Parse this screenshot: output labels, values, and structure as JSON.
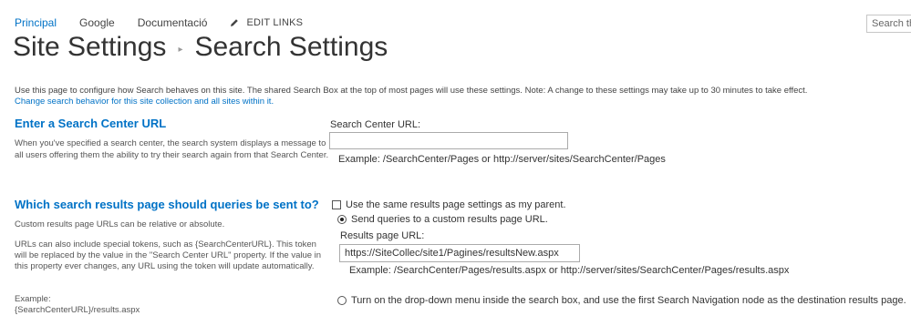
{
  "nav": {
    "items": [
      "Principal",
      "Google",
      "Documentació"
    ],
    "edit_links": "EDIT LINKS"
  },
  "search": {
    "placeholder": "Search this"
  },
  "title": {
    "part1": "Site Settings",
    "part2": "Search Settings"
  },
  "description": "Use this page to configure how Search behaves on this site. The shared Search Box at the top of most pages will use these settings. Note: A change to these settings may take up to 30 minutes to take effect.",
  "change_link": "Change search behavior for this site collection and all sites within it.",
  "section1": {
    "heading": "Enter a Search Center URL",
    "description": "When you've specified a search center, the search system displays a message to all users offering them the ability to try their search again from that Search Center.",
    "field_label": "Search Center URL:",
    "field_value": "",
    "example": "Example: /SearchCenter/Pages or http://server/sites/SearchCenter/Pages"
  },
  "section2": {
    "heading": "Which search results page should queries be sent to?",
    "text1": "Custom results page URLs can be relative or absolute.",
    "text2": "URLs can also include special tokens, such as {SearchCenterURL}. This token will be replaced by the value in the \"Search Center URL\" property. If the value in this property ever changes, any URL using the token will update automatically.",
    "text3_line1": "Example:",
    "text3_line2": "{SearchCenterURL}/results.aspx",
    "option_parent": "Use the same results page settings as my parent.",
    "option_parent_checked": false,
    "option_custom": "Send queries to a custom results page URL.",
    "option_custom_selected": true,
    "results_label": "Results page URL:",
    "results_value": "https://SiteCollec/site1/Pagines/resultsNew.aspx",
    "results_example": "Example: /SearchCenter/Pages/results.aspx or http://server/sites/SearchCenter/Pages/results.aspx",
    "option_dropdown": "Turn on the drop-down menu inside the search box, and use the first Search Navigation node as the destination results page.",
    "option_dropdown_selected": false
  }
}
